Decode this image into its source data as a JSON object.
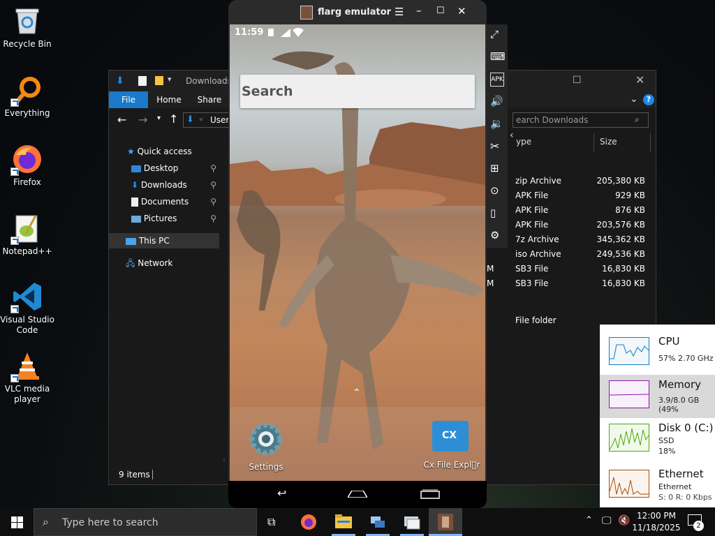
{
  "desktop": {
    "icons": [
      {
        "label": "Recycle Bin",
        "icon": "recycle-bin-icon"
      },
      {
        "label": "Everything",
        "icon": "everything-search-icon"
      },
      {
        "label": "Firefox",
        "icon": "firefox-icon"
      },
      {
        "label": "Notepad++",
        "icon": "notepadpp-icon"
      },
      {
        "label": "Visual Studio Code",
        "icon": "vscode-icon"
      },
      {
        "label": "VLC media player",
        "icon": "vlc-icon"
      }
    ]
  },
  "explorer": {
    "title": "Downloads",
    "ribbon_tabs": [
      "File",
      "Home",
      "Share"
    ],
    "address": "Users",
    "search_placeholder": "earch Downloads",
    "sidebar": [
      {
        "label": "Quick access"
      },
      {
        "label": "Desktop"
      },
      {
        "label": "Downloads"
      },
      {
        "label": "Documents"
      },
      {
        "label": "Pictures"
      },
      {
        "label": "This PC"
      },
      {
        "label": "Network"
      }
    ],
    "columns": {
      "type": "ype",
      "size": "Size"
    },
    "rows": [
      {
        "prefix": "",
        "type": "zip Archive",
        "size": "205,380 KB"
      },
      {
        "prefix": "",
        "type": "APK File",
        "size": "929 KB"
      },
      {
        "prefix": "",
        "type": "APK File",
        "size": "876 KB"
      },
      {
        "prefix": "",
        "type": "APK File",
        "size": "203,576 KB"
      },
      {
        "prefix": "",
        "type": "7z Archive",
        "size": "345,362 KB"
      },
      {
        "prefix": "",
        "type": "iso Archive",
        "size": "249,536 KB"
      },
      {
        "prefix": "M",
        "type": "SB3 File",
        "size": "16,830 KB"
      },
      {
        "prefix": "M",
        "type": "SB3 File",
        "size": "16,830 KB"
      },
      {
        "prefix": "",
        "type": "File folder",
        "size": ""
      }
    ],
    "status": "9 items"
  },
  "emulator": {
    "title": "flarg emulator",
    "status_time": "11:59",
    "search_text": "Search",
    "apps": [
      {
        "label": "Settings",
        "icon": "settings-gear-icon"
      },
      {
        "label": "Cx File Expl⃝r",
        "icon": "cx-file-explorer-icon"
      }
    ],
    "toolbar": [
      "fullscreen-icon",
      "keyboard-icon",
      "apk-install-icon",
      "volume-up-icon",
      "volume-down-icon",
      "screenshot-scissors-icon",
      "multi-instance-icon",
      "location-icon",
      "shake-icon",
      "settings-icon"
    ]
  },
  "taskmgr": {
    "items": [
      {
        "name": "CPU",
        "sub1": "57%  2.70 GHz",
        "sub2": "",
        "color": "#117dbb"
      },
      {
        "name": "Memory",
        "sub1": "3.9/8.0 GB (49%",
        "sub2": "",
        "color": "#8b12ae"
      },
      {
        "name": "Disk 0 (C:)",
        "sub1": "SSD",
        "sub2": "18%",
        "color": "#4da60c"
      },
      {
        "name": "Ethernet",
        "sub1": "Ethernet",
        "sub2": "S: 0  R: 0 Kbps",
        "color": "#a74f01"
      }
    ]
  },
  "taskbar": {
    "search_placeholder": "Type here to search",
    "time": "12:00 PM",
    "date": "11/18/2025",
    "notification_count": "2"
  }
}
